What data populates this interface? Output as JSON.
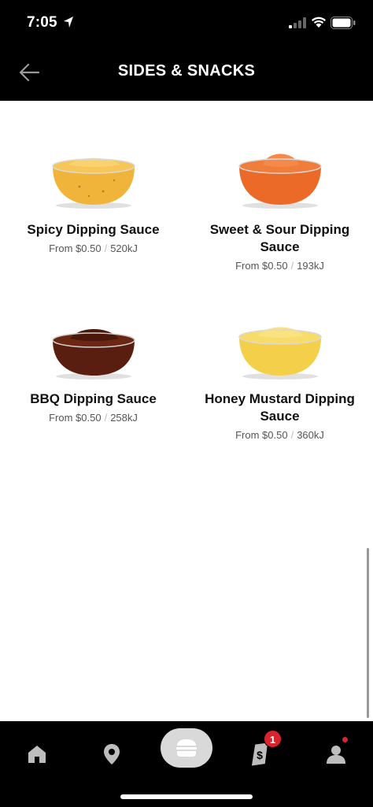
{
  "status_bar": {
    "time": "7:05"
  },
  "header": {
    "title": "SIDES & SNACKS",
    "back_icon": "arrow-left-icon"
  },
  "products": [
    {
      "name": "Spicy Dipping Sauce",
      "price": "From $0.50",
      "energy": "520kJ",
      "color": "#f0b43a"
    },
    {
      "name": "Sweet & Sour Dipping Sauce",
      "price": "From $0.50",
      "energy": "193kJ",
      "color": "#ec6a28"
    },
    {
      "name": "BBQ Dipping Sauce",
      "price": "From $0.50",
      "energy": "258kJ",
      "color": "#5a1e10"
    },
    {
      "name": "Honey Mustard Dipping Sauce",
      "price": "From $0.50",
      "energy": "360kJ",
      "color": "#f3cf4a"
    }
  ],
  "bottom_nav": {
    "items": [
      "home-icon",
      "location-icon",
      "menu-burger-icon",
      "offers-icon",
      "account-icon"
    ],
    "offers_badge": "1",
    "accent": "#d9232d"
  }
}
